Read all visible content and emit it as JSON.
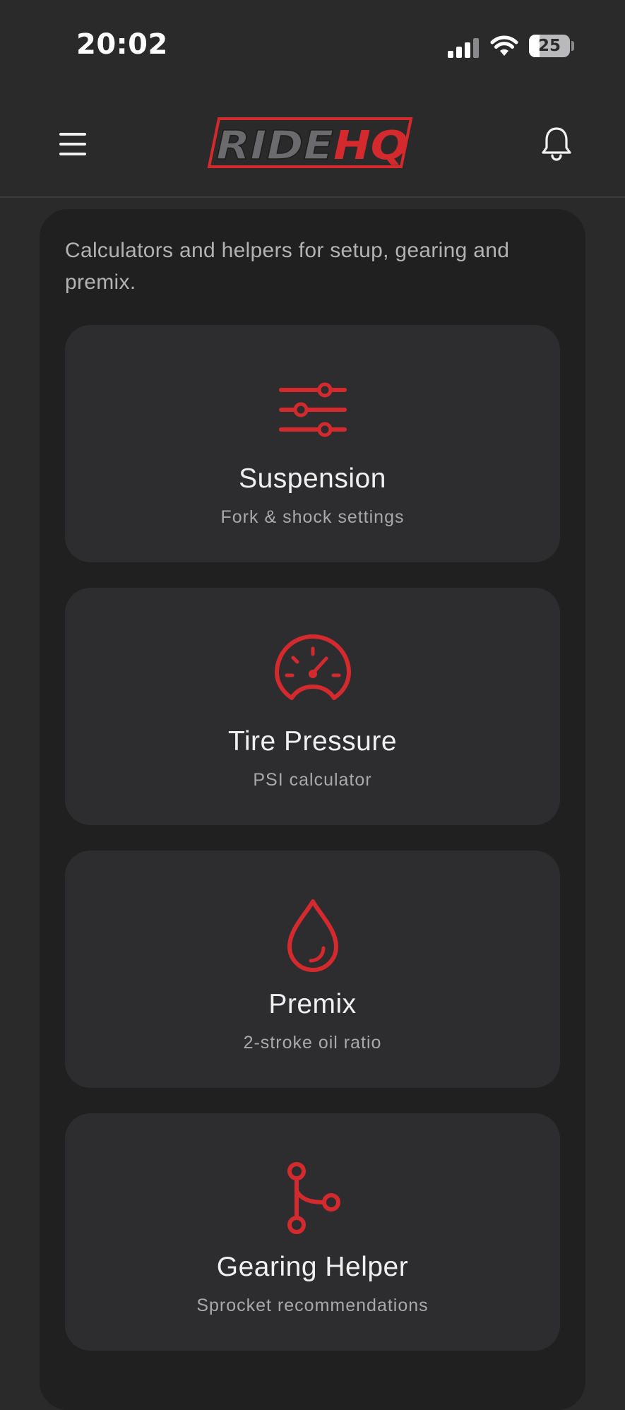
{
  "status_bar": {
    "time": "20:02",
    "battery_level": "25",
    "battery_fraction": 0.25,
    "signal_bars_active": 3
  },
  "header": {
    "logo_part1": "RIDE",
    "logo_part2": "HQ",
    "menu_icon": "hamburger-menu-icon",
    "notifications_icon": "bell-icon"
  },
  "intro_text": "Calculators and helpers for setup, gearing and premix.",
  "tools": [
    {
      "title": "Suspension",
      "subtitle": "Fork & shock settings",
      "icon": "sliders-icon"
    },
    {
      "title": "Tire Pressure",
      "subtitle": "PSI calculator",
      "icon": "gauge-icon"
    },
    {
      "title": "Premix",
      "subtitle": "2-stroke oil ratio",
      "icon": "oil-drop-icon"
    },
    {
      "title": "Gearing Helper",
      "subtitle": "Sprocket recommendations",
      "icon": "sprocket-branch-icon"
    }
  ],
  "colors": {
    "accent": "#d42a2e",
    "background": "#2a2a2b",
    "panel": "#202021",
    "card": "#2d2d2f",
    "logo_gray": "#6b6b6d"
  }
}
